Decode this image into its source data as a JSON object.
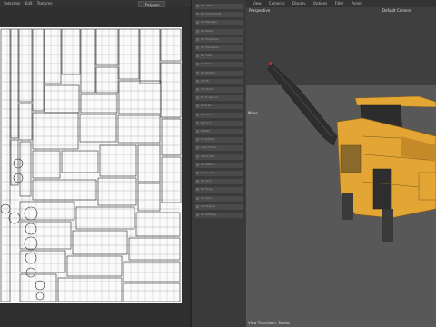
{
  "uv_editor": {
    "menu": [
      "Selection",
      "Edit",
      "Textures"
    ],
    "dropdown_value": "Polygon"
  },
  "tools_panel": {
    "items": [
      "UV Tools",
      "UV Commands",
      "UV Manager",
      "UV Relax",
      "UV Projection",
      "UV Transform",
      "UV Tiles",
      "UV Pack",
      "UV Stretch",
      "UV Fit",
      "Set Pivot",
      "Fit To Region",
      "Unwrap",
      "Mirror U",
      "Mirror V",
      "Rotate",
      "Straighten",
      "Align Edges",
      "Stack UVs",
      "UV Islands",
      "UV Seams",
      "UV Grid",
      "UV Snap",
      "UV Sync",
      "UV Display",
      "UV Settings"
    ]
  },
  "viewport": {
    "menu": [
      "View",
      "Cameras",
      "Display",
      "Options",
      "Filter",
      "Panel"
    ],
    "label": "Perspective",
    "camera": "Default Camera",
    "move_label": "Move",
    "footer": "View Transform: Scales"
  },
  "colors": {
    "truck": "#e3a534",
    "truck_dark": "#7a5a22",
    "uv_lines": "#2a2a2a"
  }
}
